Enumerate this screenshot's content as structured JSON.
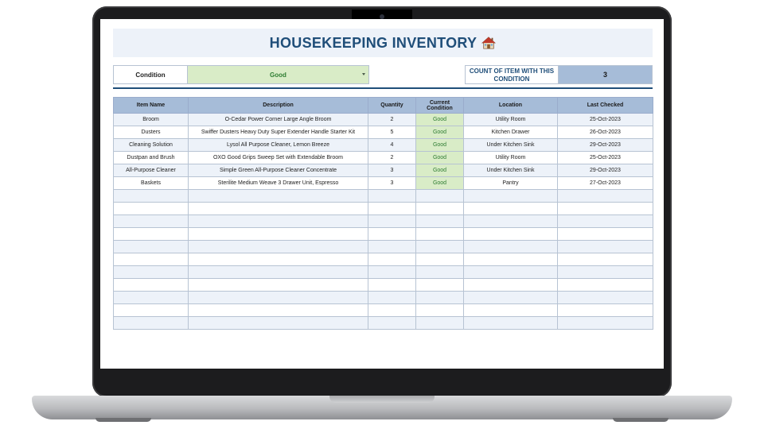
{
  "sheet": {
    "title": "HOUSEKEEPING INVENTORY",
    "title_icon": "house-icon",
    "filter": {
      "label": "Condition",
      "value": "Good"
    },
    "count": {
      "label": "COUNT OF ITEM WITH THIS CONDITION",
      "value": "3"
    }
  },
  "table": {
    "headers": [
      "Item Name",
      "Description",
      "Quantity",
      "Current Condition",
      "Location",
      "Last Checked"
    ],
    "rows": [
      [
        "Broom",
        "O-Cedar Power Corner Large Angle Broom",
        "2",
        "Good",
        "Utility Room",
        "25-Oct-2023"
      ],
      [
        "Dusters",
        "Swiffer Dusters Heavy Duty Super Extender Handle Starter Kit",
        "5",
        "Good",
        "Kitchen Drawer",
        "26-Oct-2023"
      ],
      [
        "Cleaning Solution",
        "Lysol All Purpose Cleaner, Lemon Breeze",
        "4",
        "Good",
        "Under Kitchen Sink",
        "29-Oct-2023"
      ],
      [
        "Dustpan and Brush",
        "OXO Good Grips Sweep Set with Extendable Broom",
        "2",
        "Good",
        "Utility Room",
        "25-Oct-2023"
      ],
      [
        "All-Purpose Cleaner",
        "Simple Green All-Purpose Cleaner Concentrate",
        "3",
        "Good",
        "Under Kitchen Sink",
        "29-Oct-2023"
      ],
      [
        "Baskets",
        "Sterilite Medium Weave 3 Drawer Unit, Espresso",
        "3",
        "Good",
        "Pantry",
        "27-Oct-2023"
      ]
    ],
    "empty_rows": 11
  },
  "colors": {
    "title": "#1f4e79",
    "header_fill": "#a6bcd8",
    "alt_row": "#edf2f9",
    "good_fill": "#d9ecc7",
    "good_text": "#2e7d32"
  }
}
